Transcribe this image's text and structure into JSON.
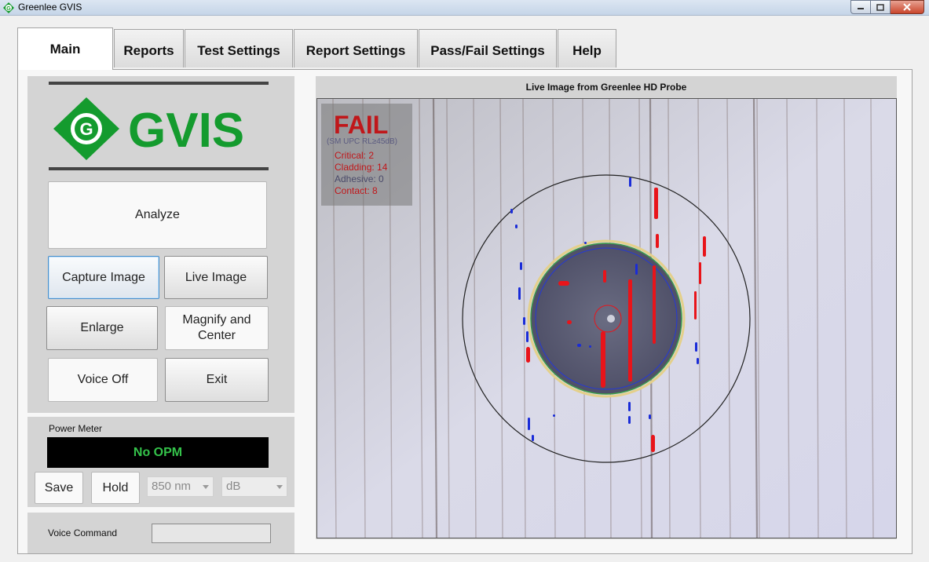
{
  "window": {
    "title": "Greenlee GVIS"
  },
  "tabs": [
    {
      "label": "Main"
    },
    {
      "label": "Reports"
    },
    {
      "label": "Test Settings"
    },
    {
      "label": "Report Settings"
    },
    {
      "label": "Pass/Fail Settings"
    },
    {
      "label": "Help"
    }
  ],
  "logo": {
    "text": "GVIS",
    "letter": "G",
    "color": "#149b2e"
  },
  "buttons": {
    "analyze": "Analyze",
    "capture_image": "Capture Image",
    "live_image": "Live Image",
    "enlarge": "Enlarge",
    "magnify_center_1": "Magnify and",
    "magnify_center_2": "Center",
    "voice_off": "Voice Off",
    "exit": "Exit"
  },
  "power_meter": {
    "label": "Power Meter",
    "display": "No OPM",
    "save": "Save",
    "hold": "Hold",
    "wavelength": "850 nm",
    "unit": "dB"
  },
  "voice_command": {
    "label": "Voice Command",
    "value": ""
  },
  "live_image": {
    "title": "Live Image from Greenlee HD Probe",
    "result": "FAIL",
    "criteria": "(SM UPC RL≥45dB)",
    "stats": [
      {
        "text": "Critical: 2",
        "color": "#c0171a"
      },
      {
        "text": "Cladding: 14",
        "color": "#c0171a"
      },
      {
        "text": "Adhesive: 0",
        "color": "#4a4a6a"
      },
      {
        "text": "Contact: 8",
        "color": "#c0171a"
      }
    ]
  },
  "colors": {
    "fail_red": "#c0171a",
    "defect_red": "#e8141a",
    "defect_blue": "#1a2cd8",
    "opm_green": "#34c24a"
  }
}
